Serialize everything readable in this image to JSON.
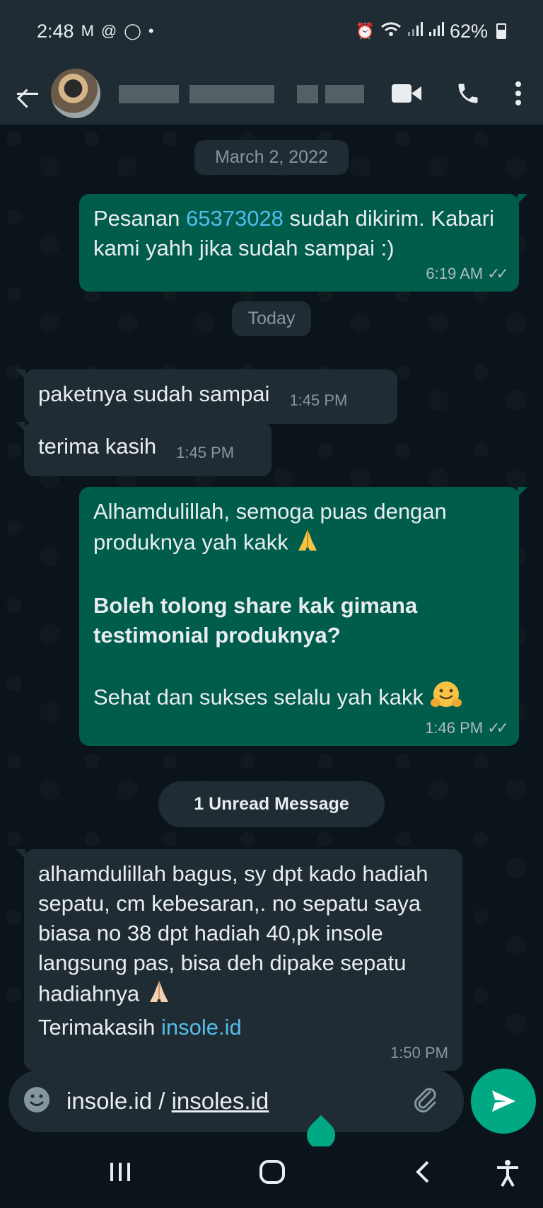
{
  "status_bar": {
    "time": "2:48",
    "notif_icons": [
      "gmail-icon",
      "threads-icon",
      "whatsapp-icon"
    ],
    "battery": "62%"
  },
  "header": {
    "contact_name_blurred": true,
    "icons": [
      "back-arrow-icon",
      "video-call-icon",
      "phone-icon",
      "more-vert-icon"
    ]
  },
  "chat": {
    "date_march": "March 2, 2022",
    "date_today": "Today",
    "unread": "1 Unread Message",
    "msg1": {
      "pre": "Pesanan ",
      "order_number": "65373028",
      "post": " sudah dikirim. Kabari kami yahh jika sudah sampai :)",
      "time": "6:19 AM"
    },
    "msg2": {
      "text": "paketnya sudah sampai",
      "time": "1:45 PM"
    },
    "msg3": {
      "text": "terima kasih",
      "time": "1:45 PM"
    },
    "msg4": {
      "line1": "Alhamdulillah, semoga puas dengan produknya yah kakk",
      "line2": "Boleh tolong share kak gimana testimonial produknya?",
      "line3": "Sehat dan sukses selalu yah kakk",
      "time": "1:46 PM"
    },
    "msg5": {
      "text": "alhamdulillah bagus, sy dpt kado hadiah sepatu, cm kebesaran,. no sepatu saya biasa no 38 dpt hadiah 40,pk insole langsung pas, bisa deh dipake sepatu hadiahnya",
      "thanks": "Terimakasih ",
      "link": "insole.id",
      "time": "1:50 PM"
    }
  },
  "input": {
    "prefix": "insole.id / ",
    "underlined": "insoles.id"
  },
  "colors": {
    "outgoing": "#005c4b",
    "incoming": "#202c33",
    "accent": "#00a884",
    "link": "#53bdeb"
  }
}
